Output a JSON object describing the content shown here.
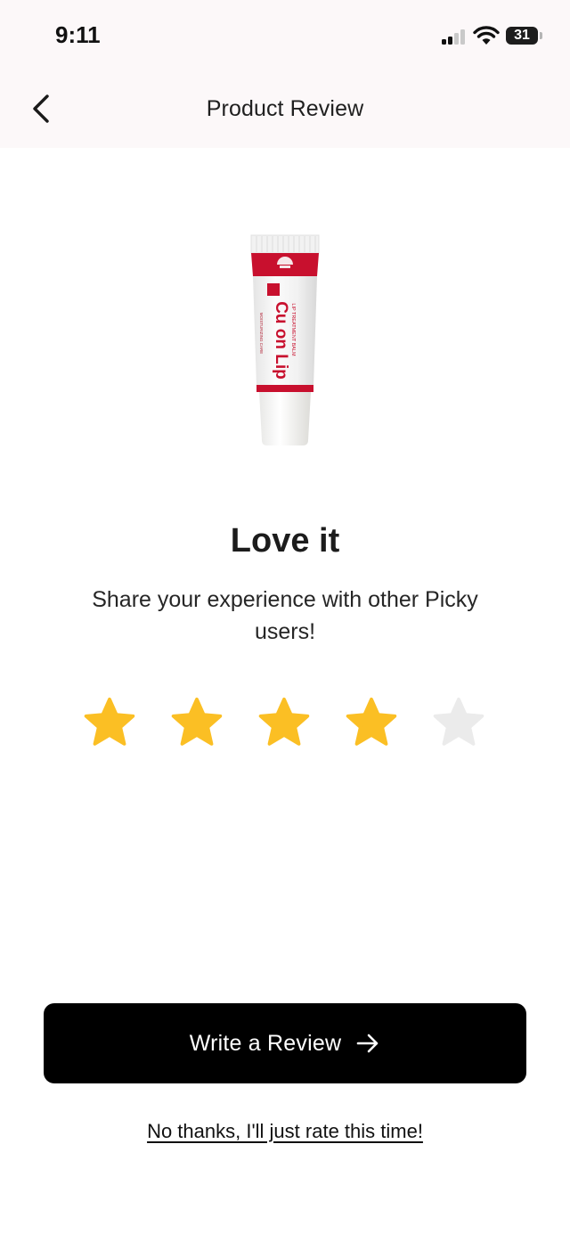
{
  "status_bar": {
    "time": "9:11",
    "battery_level": "31",
    "icons": [
      "cellular-signal-icon",
      "wifi-icon",
      "battery-icon"
    ]
  },
  "header": {
    "title": "Product Review",
    "back_icon": "chevron-left-icon"
  },
  "product": {
    "image": "lip-tube-product-image",
    "brand_text": "Cu on Lip",
    "accent_color": "#c8102e"
  },
  "rating": {
    "label": "Love it",
    "prompt": "Share your experience with other Picky users!",
    "value": 4,
    "max": 5,
    "filled_color": "#fbbf24",
    "empty_color": "#ebebeb"
  },
  "actions": {
    "write_review_label": "Write a Review",
    "write_review_icon": "arrow-right-icon",
    "skip_label": "No thanks, I'll just rate this time!"
  }
}
